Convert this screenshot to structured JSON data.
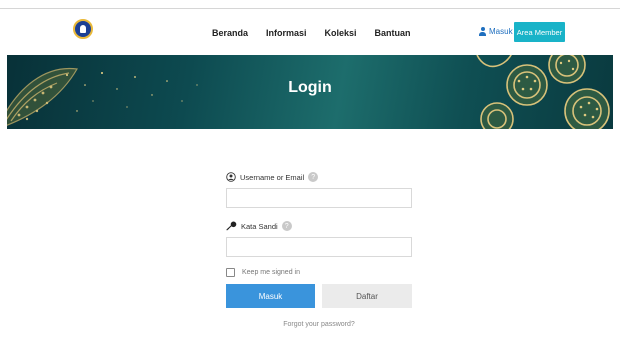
{
  "header": {
    "nav": [
      "Beranda",
      "Informasi",
      "Koleksi",
      "Bantuan"
    ],
    "login_link": "Masuk",
    "member_button": "Area Member",
    "logo_icon": "education-ministry-logo-icon"
  },
  "banner": {
    "title": "Login"
  },
  "form": {
    "username_label": "Username or Email",
    "password_label": "Kata Sandi",
    "username_value": "",
    "password_value": "",
    "username_icon": "user-circle-icon",
    "password_icon": "key-icon",
    "help_icon": "question-icon",
    "show_password_icon": "eye-icon",
    "remember_label": "Keep me signed in",
    "remember_checked": false,
    "submit_label": "Masuk",
    "register_label": "Daftar",
    "forgot_link": "Forgot your password?"
  },
  "colors": {
    "accent_blue": "#3a94dc",
    "member_teal": "#19b3c8",
    "banner_teal": "#0d4a50"
  }
}
